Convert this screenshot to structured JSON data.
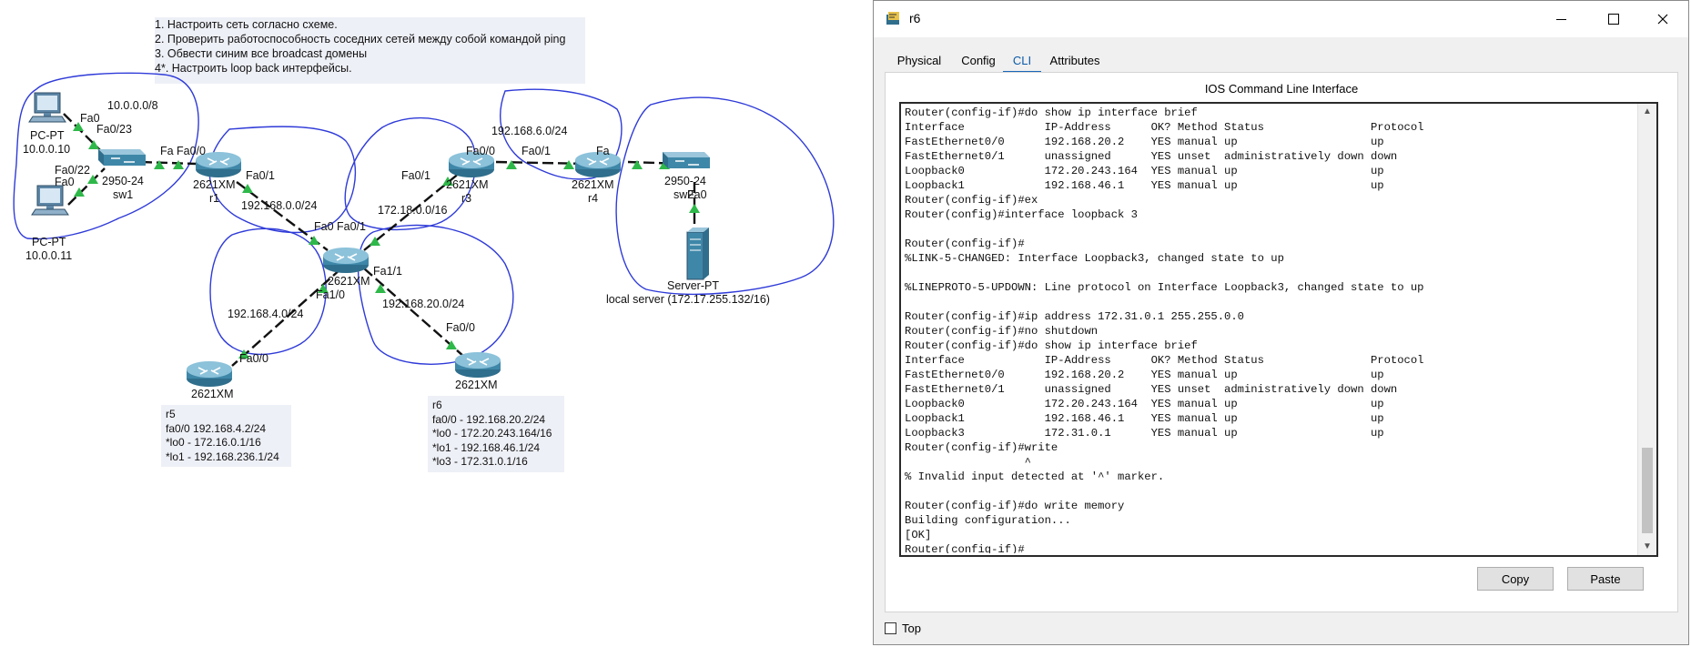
{
  "tasks": [
    "1. Настроить сеть согласно схеме.",
    "2. Проверить работоспособность соседних сетей между собой командой ping",
    "3. Обвести синим все broadcast домены",
    "4*. Настроить loop back интерфейсы."
  ],
  "topology": {
    "pc1": {
      "type": "PC-PT",
      "ip": "10.0.0.10"
    },
    "pc2": {
      "type": "PC-PT",
      "ip": "10.0.0.11"
    },
    "sw1": {
      "model": "2950-24",
      "name": "sw1"
    },
    "r1": {
      "model": "2621XM",
      "name": "r1"
    },
    "r2": {
      "model": "2621XM"
    },
    "r3": {
      "model": "2621XM",
      "name": "r3"
    },
    "r4": {
      "model": "2621XM",
      "name": "r4"
    },
    "r5": {
      "model": "2621XM"
    },
    "r6": {
      "model": "2621XM"
    },
    "sw2": {
      "model": "2950-24",
      "name": "sw2"
    },
    "server": {
      "type": "Server-PT",
      "label": "local server (172.17.255.132/16)"
    },
    "networks": [
      "10.0.0.0/8",
      "192.168.0.0/24",
      "172.18.0.0/16",
      "192.168.6.0/24",
      "192.168.4.0/24",
      "192.168.20.0/24"
    ],
    "ports": {
      "pc1_fa0": "Fa0",
      "sw1_to_pc1": "Fa0/23",
      "sw1_to_pc2": "Fa0/22",
      "pc2_fa0": "Fa0",
      "sw1_to_r1": "Fa",
      "r1_fa00": "Fa0/0",
      "r1_fa01": "Fa0/1",
      "r2_fa00": "Fa0",
      "r2_fa01": "Fa0/1",
      "r2_fa11": "Fa1/1",
      "r2_fa10": "Fa1/0",
      "r3_fa01": "Fa0/1",
      "r3_fa00": "Fa0/0",
      "r4_fa01": "Fa0/1",
      "r4_fa": "Fa",
      "sw2_fa0": "Fa0",
      "r5_fa00": "Fa0/0",
      "r6_fa00": "Fa0/0"
    },
    "r5_note": [
      "r5",
      "fa0/0 192.168.4.2/24",
      "*lo0 - 172.16.0.1/16",
      "*lo1 - 192.168.236.1/24"
    ],
    "r6_note": [
      "r6",
      "fa0/0 - 192.168.20.2/24",
      "*lo0 - 172.20.243.164/16",
      "*lo1 - 192.168.46.1/24",
      "*lo3 - 172.31.0.1/16"
    ]
  },
  "window": {
    "title": "r6",
    "tabs": [
      {
        "label": "Physical",
        "active": false
      },
      {
        "label": "Config",
        "active": false
      },
      {
        "label": "CLI",
        "active": true
      },
      {
        "label": "Attributes",
        "active": false
      }
    ],
    "panel_title": "IOS Command Line Interface",
    "console_lines": [
      "Router(config-if)#do show ip interface brief",
      "Interface            IP-Address      OK? Method Status                Protocol",
      "FastEthernet0/0      192.168.20.2    YES manual up                    up",
      "FastEthernet0/1      unassigned      YES unset  administratively down down",
      "Loopback0            172.20.243.164  YES manual up                    up",
      "Loopback1            192.168.46.1    YES manual up                    up",
      "Router(config-if)#ex",
      "Router(config)#interface loopback 3",
      "",
      "Router(config-if)#",
      "%LINK-5-CHANGED: Interface Loopback3, changed state to up",
      "",
      "%LINEPROTO-5-UPDOWN: Line protocol on Interface Loopback3, changed state to up",
      "",
      "Router(config-if)#ip address 172.31.0.1 255.255.0.0",
      "Router(config-if)#no shutdown",
      "Router(config-if)#do show ip interface brief",
      "Interface            IP-Address      OK? Method Status                Protocol",
      "FastEthernet0/0      192.168.20.2    YES manual up                    up",
      "FastEthernet0/1      unassigned      YES unset  administratively down down",
      "Loopback0            172.20.243.164  YES manual up                    up",
      "Loopback1            192.168.46.1    YES manual up                    up",
      "Loopback3            172.31.0.1      YES manual up                    up",
      "Router(config-if)#write",
      "                  ^",
      "% Invalid input detected at '^' marker.",
      "",
      "Router(config-if)#do write memory",
      "Building configuration...",
      "[OK]",
      "Router(config-if)#"
    ],
    "buttons": {
      "copy": "Copy",
      "paste": "Paste"
    },
    "top_checkbox": {
      "label": "Top",
      "checked": false
    }
  },
  "colors": {
    "cable": "#111111",
    "link_light": "#2fb84a",
    "broadcast_outline": "#2f3bd8",
    "router": "#3f87a8",
    "accent_tab": "#1a66b8"
  }
}
